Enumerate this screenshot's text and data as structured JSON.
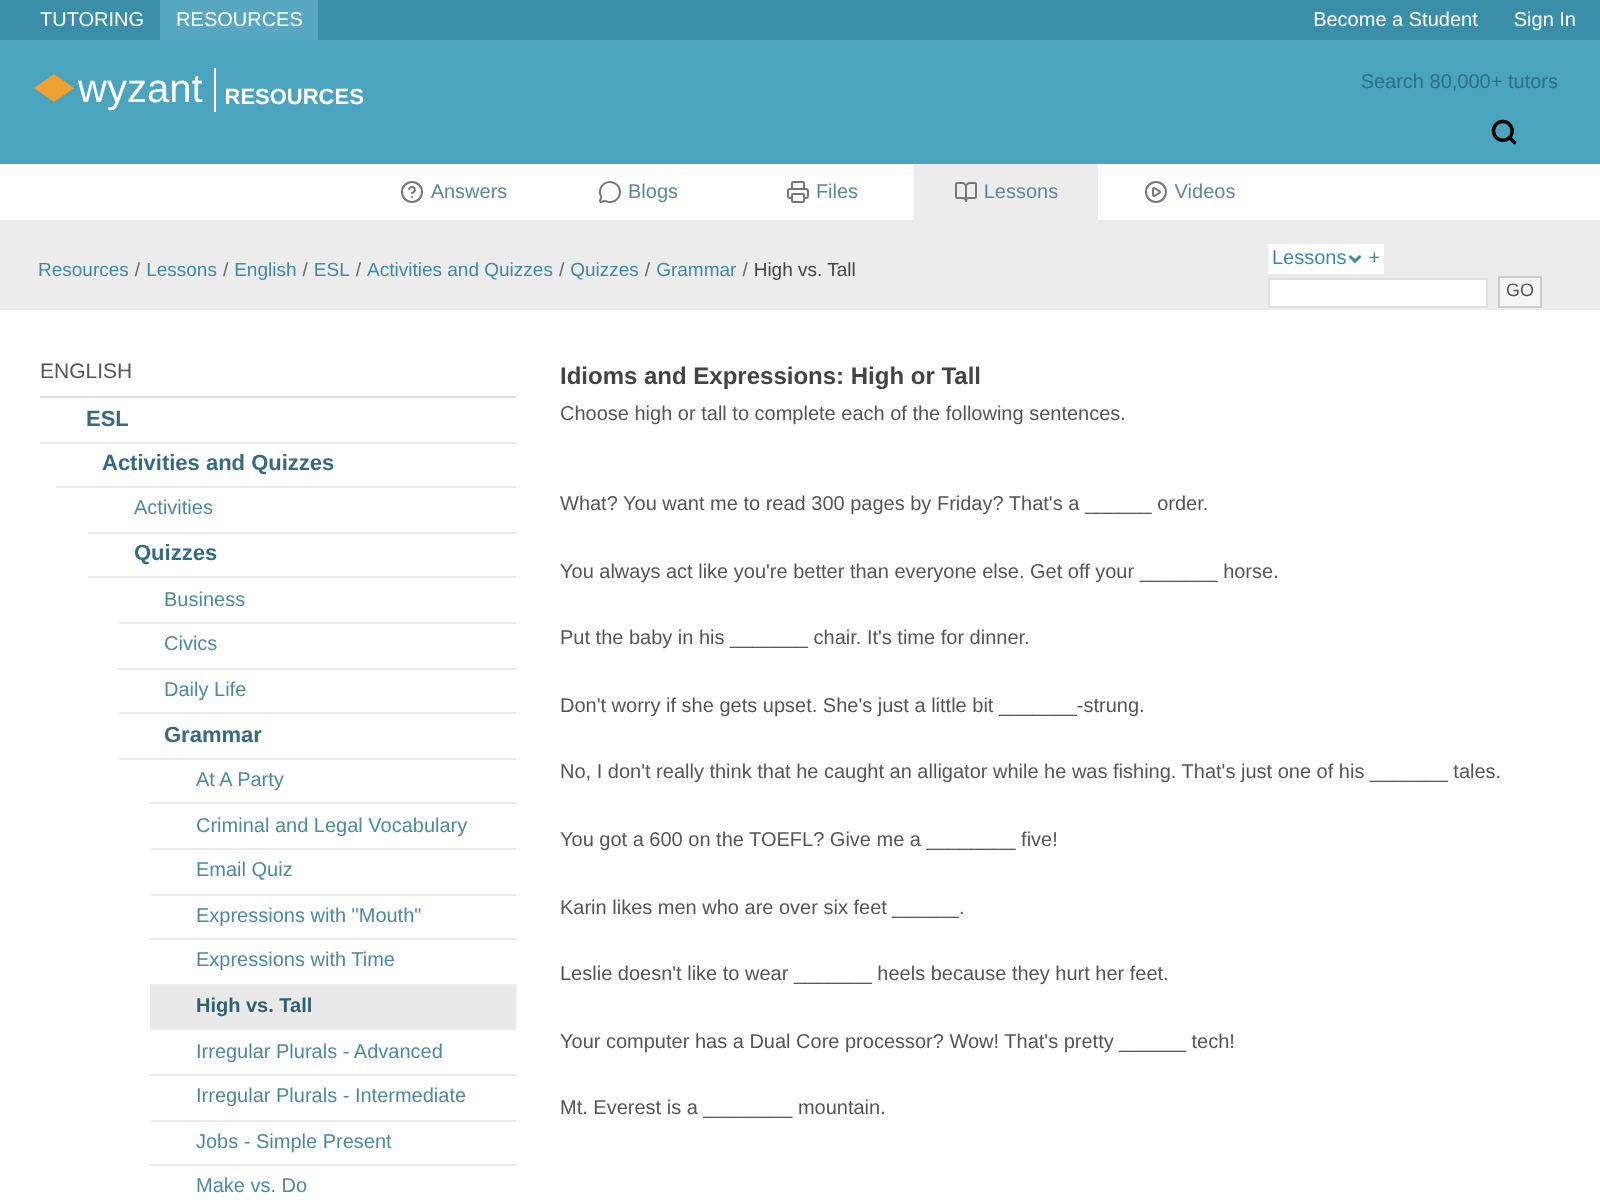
{
  "top_bar": {
    "tabs": [
      {
        "label": "TUTORING",
        "selected": false
      },
      {
        "label": "RESOURCES",
        "selected": true
      }
    ],
    "links": [
      "Become a Student",
      "Sign In"
    ]
  },
  "header": {
    "logo": "wyzant",
    "section": "RESOURCES",
    "search_label": "Search 80,000+ tutors"
  },
  "nav": [
    {
      "label": "Answers",
      "kind": "answers",
      "selected": false
    },
    {
      "label": "Blogs",
      "kind": "blogs",
      "selected": false
    },
    {
      "label": "Files",
      "kind": "files",
      "selected": false
    },
    {
      "label": "Lessons",
      "kind": "lessons",
      "selected": true
    },
    {
      "label": "Videos",
      "kind": "videos",
      "selected": false
    }
  ],
  "breadcrumb": {
    "links": [
      "Resources",
      "Lessons",
      "English",
      "ESL",
      "Activities and Quizzes",
      "Quizzes",
      "Grammar"
    ],
    "separator": "/",
    "current": "High vs. Tall"
  },
  "lesson_search": {
    "menu": "Lessons",
    "add": "+",
    "button": "GO"
  },
  "sidebar": {
    "title": "ENGLISH",
    "tree": [
      {
        "label": "ESL",
        "expanded": true,
        "selected": false,
        "children": [
          {
            "label": "Activities and Quizzes",
            "expanded": true,
            "selected": false,
            "children": [
              {
                "label": "Activities",
                "selected": false
              },
              {
                "label": "Quizzes",
                "expanded": true,
                "selected": false,
                "children": [
                  {
                    "label": "Business",
                    "selected": false
                  },
                  {
                    "label": "Civics",
                    "selected": false
                  },
                  {
                    "label": "Daily Life",
                    "selected": false
                  },
                  {
                    "label": "Grammar",
                    "expanded": true,
                    "selected": false,
                    "children": [
                      {
                        "label": "At A Party",
                        "selected": false
                      },
                      {
                        "label": "Criminal and Legal Vocabulary",
                        "selected": false
                      },
                      {
                        "label": "Email Quiz",
                        "selected": false
                      },
                      {
                        "label": "Expressions with \"Mouth\"",
                        "selected": false
                      },
                      {
                        "label": "Expressions with Time",
                        "selected": false
                      },
                      {
                        "label": "High vs. Tall",
                        "selected": true
                      },
                      {
                        "label": "Irregular Plurals - Advanced",
                        "selected": false
                      },
                      {
                        "label": "Irregular Plurals - Intermediate",
                        "selected": false
                      },
                      {
                        "label": "Jobs - Simple Present",
                        "selected": false
                      },
                      {
                        "label": "Make vs. Do",
                        "selected": false
                      }
                    ]
                  }
                ]
              }
            ]
          }
        ]
      }
    ]
  },
  "article": {
    "title": "Idioms and Expressions: High or Tall",
    "intro": "Choose high or tall to complete each of the following sentences.",
    "sentences": [
      "What? You want me to read 300 pages by Friday? That's a ______ order.",
      "You always act like you're better than everyone else. Get off your _______ horse.",
      "Put the baby in his _______ chair. It's time for dinner.",
      "Don't worry if she gets upset. She's just a little bit _______-strung.",
      "No, I don't really think that he caught an alligator while he was fishing. That's just one of his _______ tales.",
      "You got a 600 on the TOEFL? Give me a ________ five!",
      "Karin likes men who are over six feet ______.",
      "Leslie doesn't like to wear _______ heels because they hurt her feet.",
      "Your computer has a Dual Core processor? Wow! That's pretty ______ tech!",
      "Mt. Everest is a ________ mountain."
    ]
  }
}
